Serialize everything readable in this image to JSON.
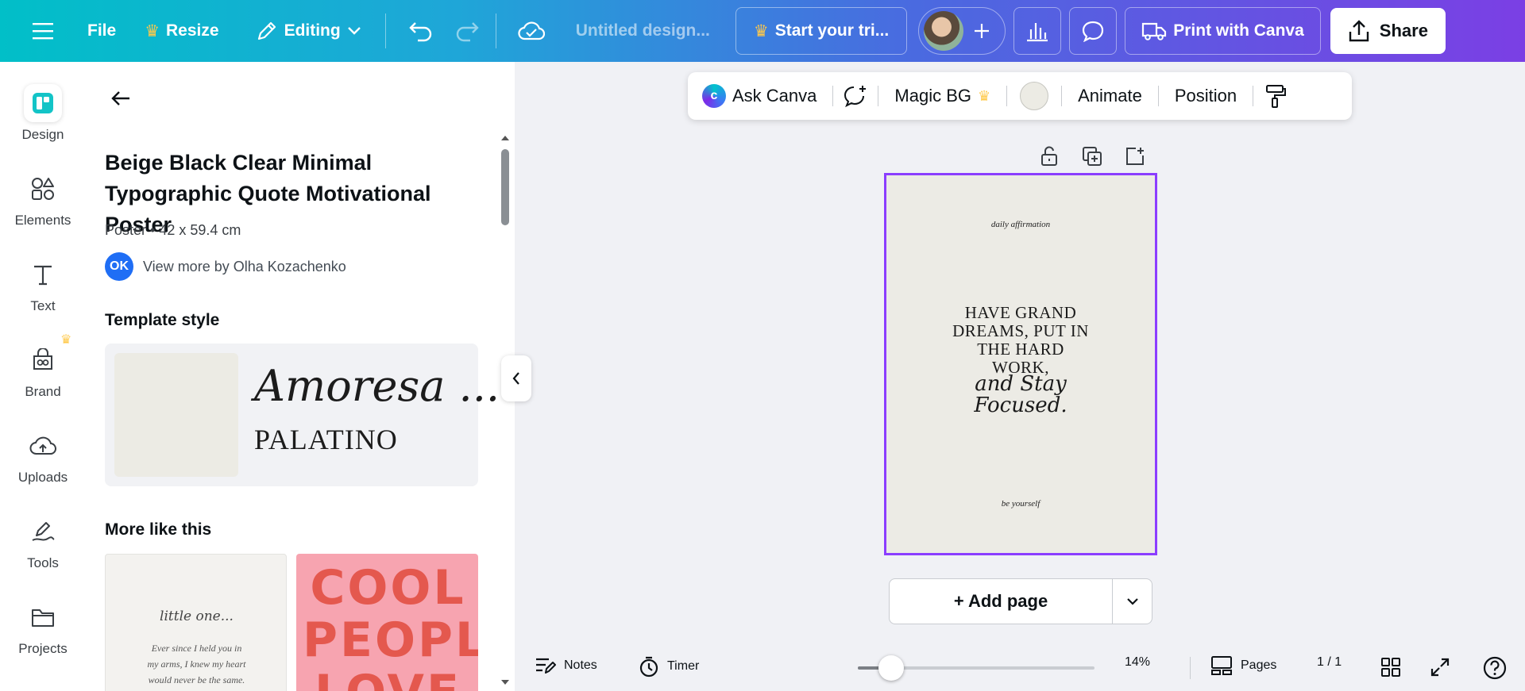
{
  "topbar": {
    "file": "File",
    "resize": "Resize",
    "editing": "Editing",
    "title": "Untitled design...",
    "trial": "Start your tri...",
    "print": "Print with Canva",
    "share": "Share"
  },
  "rail": {
    "design": "Design",
    "elements": "Elements",
    "text": "Text",
    "brand": "Brand",
    "uploads": "Uploads",
    "tools": "Tools",
    "projects": "Projects"
  },
  "panel": {
    "title": "Beige Black Clear Minimal Typographic Quote Motivational Poster",
    "meta": "Poster • 42 x 59.4 cm",
    "author_initials": "OK",
    "author_link": "View more by Olha Kozachenko",
    "template_style_heading": "Template style",
    "style_font_script": "Amoresa ...",
    "style_font_serif": "PALATINO",
    "more_heading": "More like this",
    "thumb1_script": "little one...",
    "thumb1_line1": "Ever since I held you in",
    "thumb1_line2": "my arms, I knew my heart",
    "thumb1_line3": "would never be the same.",
    "thumb2_text": "COOL PEOPLE LOVE"
  },
  "context_toolbar": {
    "ask_canva": "Ask Canva",
    "magic_bg": "Magic BG",
    "animate": "Animate",
    "position": "Position",
    "bg_color": "#ecebe4"
  },
  "poster": {
    "top": "daily affirmation",
    "main_line1": "HAVE GRAND",
    "main_line2": "DREAMS, PUT IN",
    "main_line3": "THE HARD",
    "main_line4": "WORK,",
    "script_line1": "and Stay",
    "script_line2": "Focused.",
    "bottom": "be yourself"
  },
  "canvas": {
    "add_page": "+ Add page"
  },
  "bottombar": {
    "notes": "Notes",
    "timer": "Timer",
    "zoom": "14%",
    "zoom_level": 0.14,
    "pages": "Pages",
    "page_count": "1 / 1"
  },
  "colors": {
    "accent": "#8b3dff",
    "crown": "#ffc94a"
  }
}
